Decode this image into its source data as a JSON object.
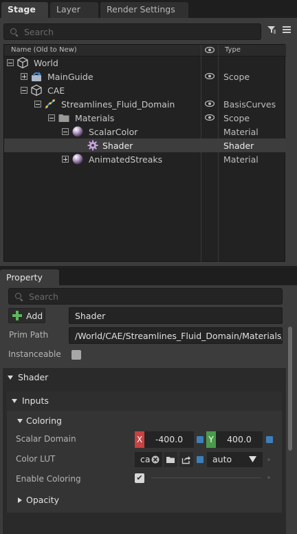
{
  "stage": {
    "tabs": [
      {
        "label": "Stage"
      },
      {
        "label": "Layer"
      },
      {
        "label": "Render Settings"
      }
    ],
    "search_placeholder": "Search",
    "tree_header": {
      "name": "Name (Old to New)",
      "type": "Type",
      "visibility_icon": "eye-icon"
    },
    "rows": [
      {
        "label": "World",
        "type": "",
        "icon": "cube-icon"
      },
      {
        "label": "MainGuide",
        "type": "Scope",
        "icon": "reference-icon"
      },
      {
        "label": "CAE",
        "type": "",
        "icon": "cube-icon"
      },
      {
        "label": "Streamlines_Fluid_Domain",
        "type": "BasisCurves",
        "icon": "curves-icon"
      },
      {
        "label": "Materials",
        "type": "Scope",
        "icon": "folder-icon"
      },
      {
        "label": "ScalarColor",
        "type": "Material",
        "icon": "material-sphere-icon"
      },
      {
        "label": "Shader",
        "type": "Shader",
        "icon": "shader-gear-icon"
      },
      {
        "label": "AnimatedStreaks",
        "type": "Material",
        "icon": "material-sphere-icon"
      }
    ]
  },
  "property": {
    "tab_label": "Property",
    "search_placeholder": "Search",
    "add_label": "Add",
    "name_value": "Shader",
    "prim_path_label": "Prim Path",
    "prim_path_value": "/World/CAE/Streamlines_Fluid_Domain/Materials/ScalarColor/Shader",
    "instanceable_label": "Instanceable",
    "shader_section": "Shader",
    "inputs_section": "Inputs",
    "coloring_section": "Coloring",
    "scalar_domain_label": "Scalar Domain",
    "scalar_domain_x_axis": "X",
    "scalar_domain_x": "-400.0",
    "scalar_domain_y_axis": "Y",
    "scalar_domain_y": "400.0",
    "color_lut_label": "Color LUT",
    "color_lut_value": "ca",
    "color_lut_mode": "auto",
    "enable_coloring_label": "Enable Coloring",
    "enable_coloring_value": "✔",
    "opacity_section": "Opacity"
  },
  "colors": {
    "accent_blue": "#3f7fb8",
    "axis_x": "#c74242",
    "axis_y": "#4a9a4a",
    "add_green": "#5cb85c"
  }
}
